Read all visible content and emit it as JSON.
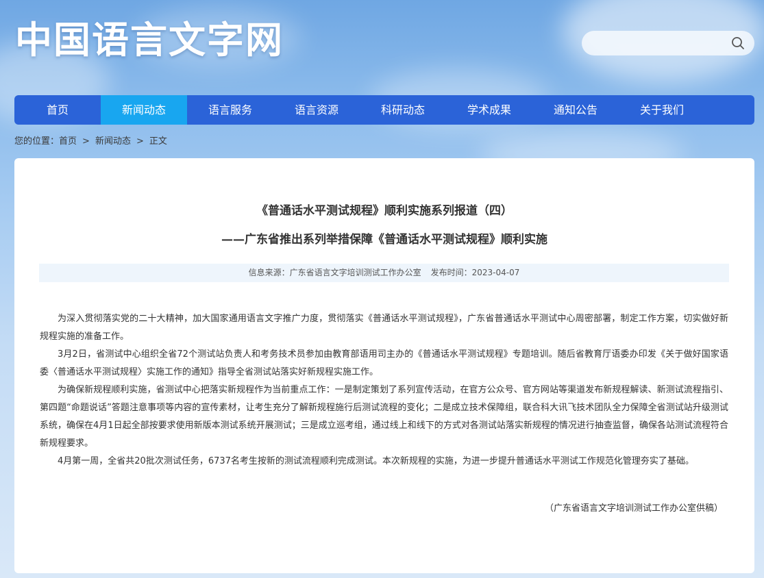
{
  "header": {
    "logo_text": "中国语言文字网",
    "search": {
      "placeholder": "",
      "icon": "search-icon"
    }
  },
  "nav": {
    "items": [
      {
        "label": "首页"
      },
      {
        "label": "新闻动态",
        "active": true
      },
      {
        "label": "语言服务"
      },
      {
        "label": "语言资源"
      },
      {
        "label": "科研动态"
      },
      {
        "label": "学术成果"
      },
      {
        "label": "通知公告"
      },
      {
        "label": "关于我们"
      }
    ],
    "colors": {
      "bar": "#2b63d8",
      "active": "#18a6f0"
    }
  },
  "breadcrumb": {
    "prefix": "您的位置：",
    "items": [
      "首页",
      "新闻动态",
      "正文"
    ],
    "separator": ">"
  },
  "article": {
    "title_line1": "《普通话水平测试规程》顺利实施系列报道（四）",
    "title_line2": "——广东省推出系列举措保障《普通话水平测试规程》顺利实施",
    "source_label": "信息来源：",
    "source": "广东省语言文字培训测试工作办公室",
    "date_label": "发布时间：",
    "date": "2023-04-07",
    "paragraphs": [
      "为深入贯彻落实党的二十大精神，加大国家通用语言文字推广力度，贯彻落实《普通话水平测试规程》，广东省普通话水平测试中心周密部署，制定工作方案，切实做好新规程实施的准备工作。",
      "3月2日，省测试中心组织全省72个测试站负责人和考务技术员参加由教育部语用司主办的《普通话水平测试规程》专题培训。随后省教育厅语委办印发《关于做好国家语委〈普通话水平测试规程〉实施工作的通知》指导全省测试站落实好新规程实施工作。",
      "为确保新规程顺利实施，省测试中心把落实新规程作为当前重点工作：一是制定策划了系列宣传活动，在官方公众号、官方网站等渠道发布新规程解读、新测试流程指引、第四题“命题说话”答题注意事项等内容的宣传素材，让考生充分了解新规程施行后测试流程的变化；二是成立技术保障组，联合科大讯飞技术团队全力保障全省测试站升级测试系统，确保在4月1日起全部按要求使用新版本测试系统开展测试；三是成立巡考组，通过线上和线下的方式对各测试站落实新规程的情况进行抽查监督，确保各站测试流程符合新规程要求。",
      "4月第一周，全省共20批次测试任务，6737名考生按新的测试流程顺利完成测试。本次新规程的实施，为进一步提升普通话水平测试工作规范化管理夯实了基础。"
    ],
    "signature": "（广东省语言文字培训测试工作办公室供稿）"
  }
}
